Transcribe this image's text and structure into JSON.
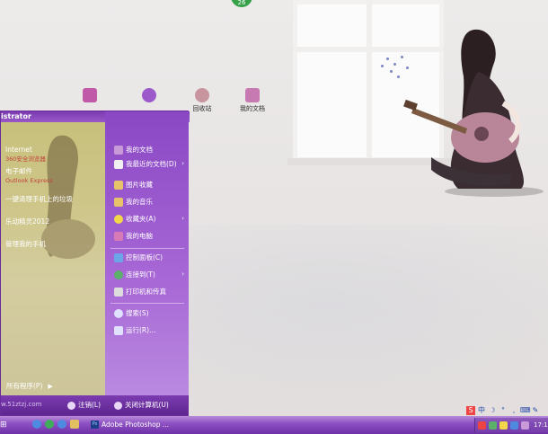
{
  "badge": {
    "text": "26"
  },
  "desktop_icons": [
    {
      "label": "",
      "color": "#c05aa8"
    },
    {
      "label": "",
      "color": "#9b59c9"
    },
    {
      "label": "回收站",
      "color": "#c8949e"
    },
    {
      "label": "我的文档",
      "color": "#c77ab2"
    }
  ],
  "start_menu": {
    "user": "istrator",
    "pinned": [
      {
        "title": "Internet",
        "subtitle": "360安全浏览器"
      },
      {
        "title": "电子邮件",
        "subtitle": "Outlook Express"
      }
    ],
    "recent": [
      "一键清理手机上的垃圾",
      "乐动精灵2012",
      "管理我的手机"
    ],
    "all_programs": "所有程序(P)",
    "right_items": [
      {
        "label": "我的文档",
        "icon": "documents-icon",
        "color": "#c89ad8"
      },
      {
        "label": "我最近的文档(D)",
        "icon": "recent-documents-icon",
        "color": "#f0f0f0",
        "submenu": true
      },
      {
        "label": "图片收藏",
        "icon": "pictures-icon",
        "color": "#e7c36a"
      },
      {
        "label": "我的音乐",
        "icon": "music-icon",
        "color": "#e7c36a"
      },
      {
        "label": "收藏夹(A)",
        "icon": "favorites-star-icon",
        "color": "#f2d74a",
        "submenu": true
      },
      {
        "label": "我的电脑",
        "icon": "my-computer-icon",
        "color": "#d77ab5"
      },
      {
        "label": "控制面板(C)",
        "icon": "control-panel-icon",
        "color": "#6aa6e8"
      },
      {
        "label": "连接到(T)",
        "icon": "connect-to-icon",
        "color": "#5bb06a",
        "submenu": true
      },
      {
        "label": "打印机和传真",
        "icon": "printer-icon",
        "color": "#dcdcdc"
      },
      {
        "label": "搜索(S)",
        "icon": "search-icon",
        "color": "#e0e0ff"
      },
      {
        "label": "运行(R)...",
        "icon": "run-icon",
        "color": "#e0e0ff"
      }
    ],
    "footer": {
      "url": "w.51ztzj.com",
      "logoff": "注销(L)",
      "shutdown": "关闭计算机(U)"
    }
  },
  "taskbar": {
    "task_label": "Adobe Photoshop ...",
    "task_icon_text": "Ps",
    "clock": "17:1"
  },
  "langbar": [
    "S",
    "中",
    "☽",
    "°",
    ",",
    "⌨",
    "✎"
  ]
}
